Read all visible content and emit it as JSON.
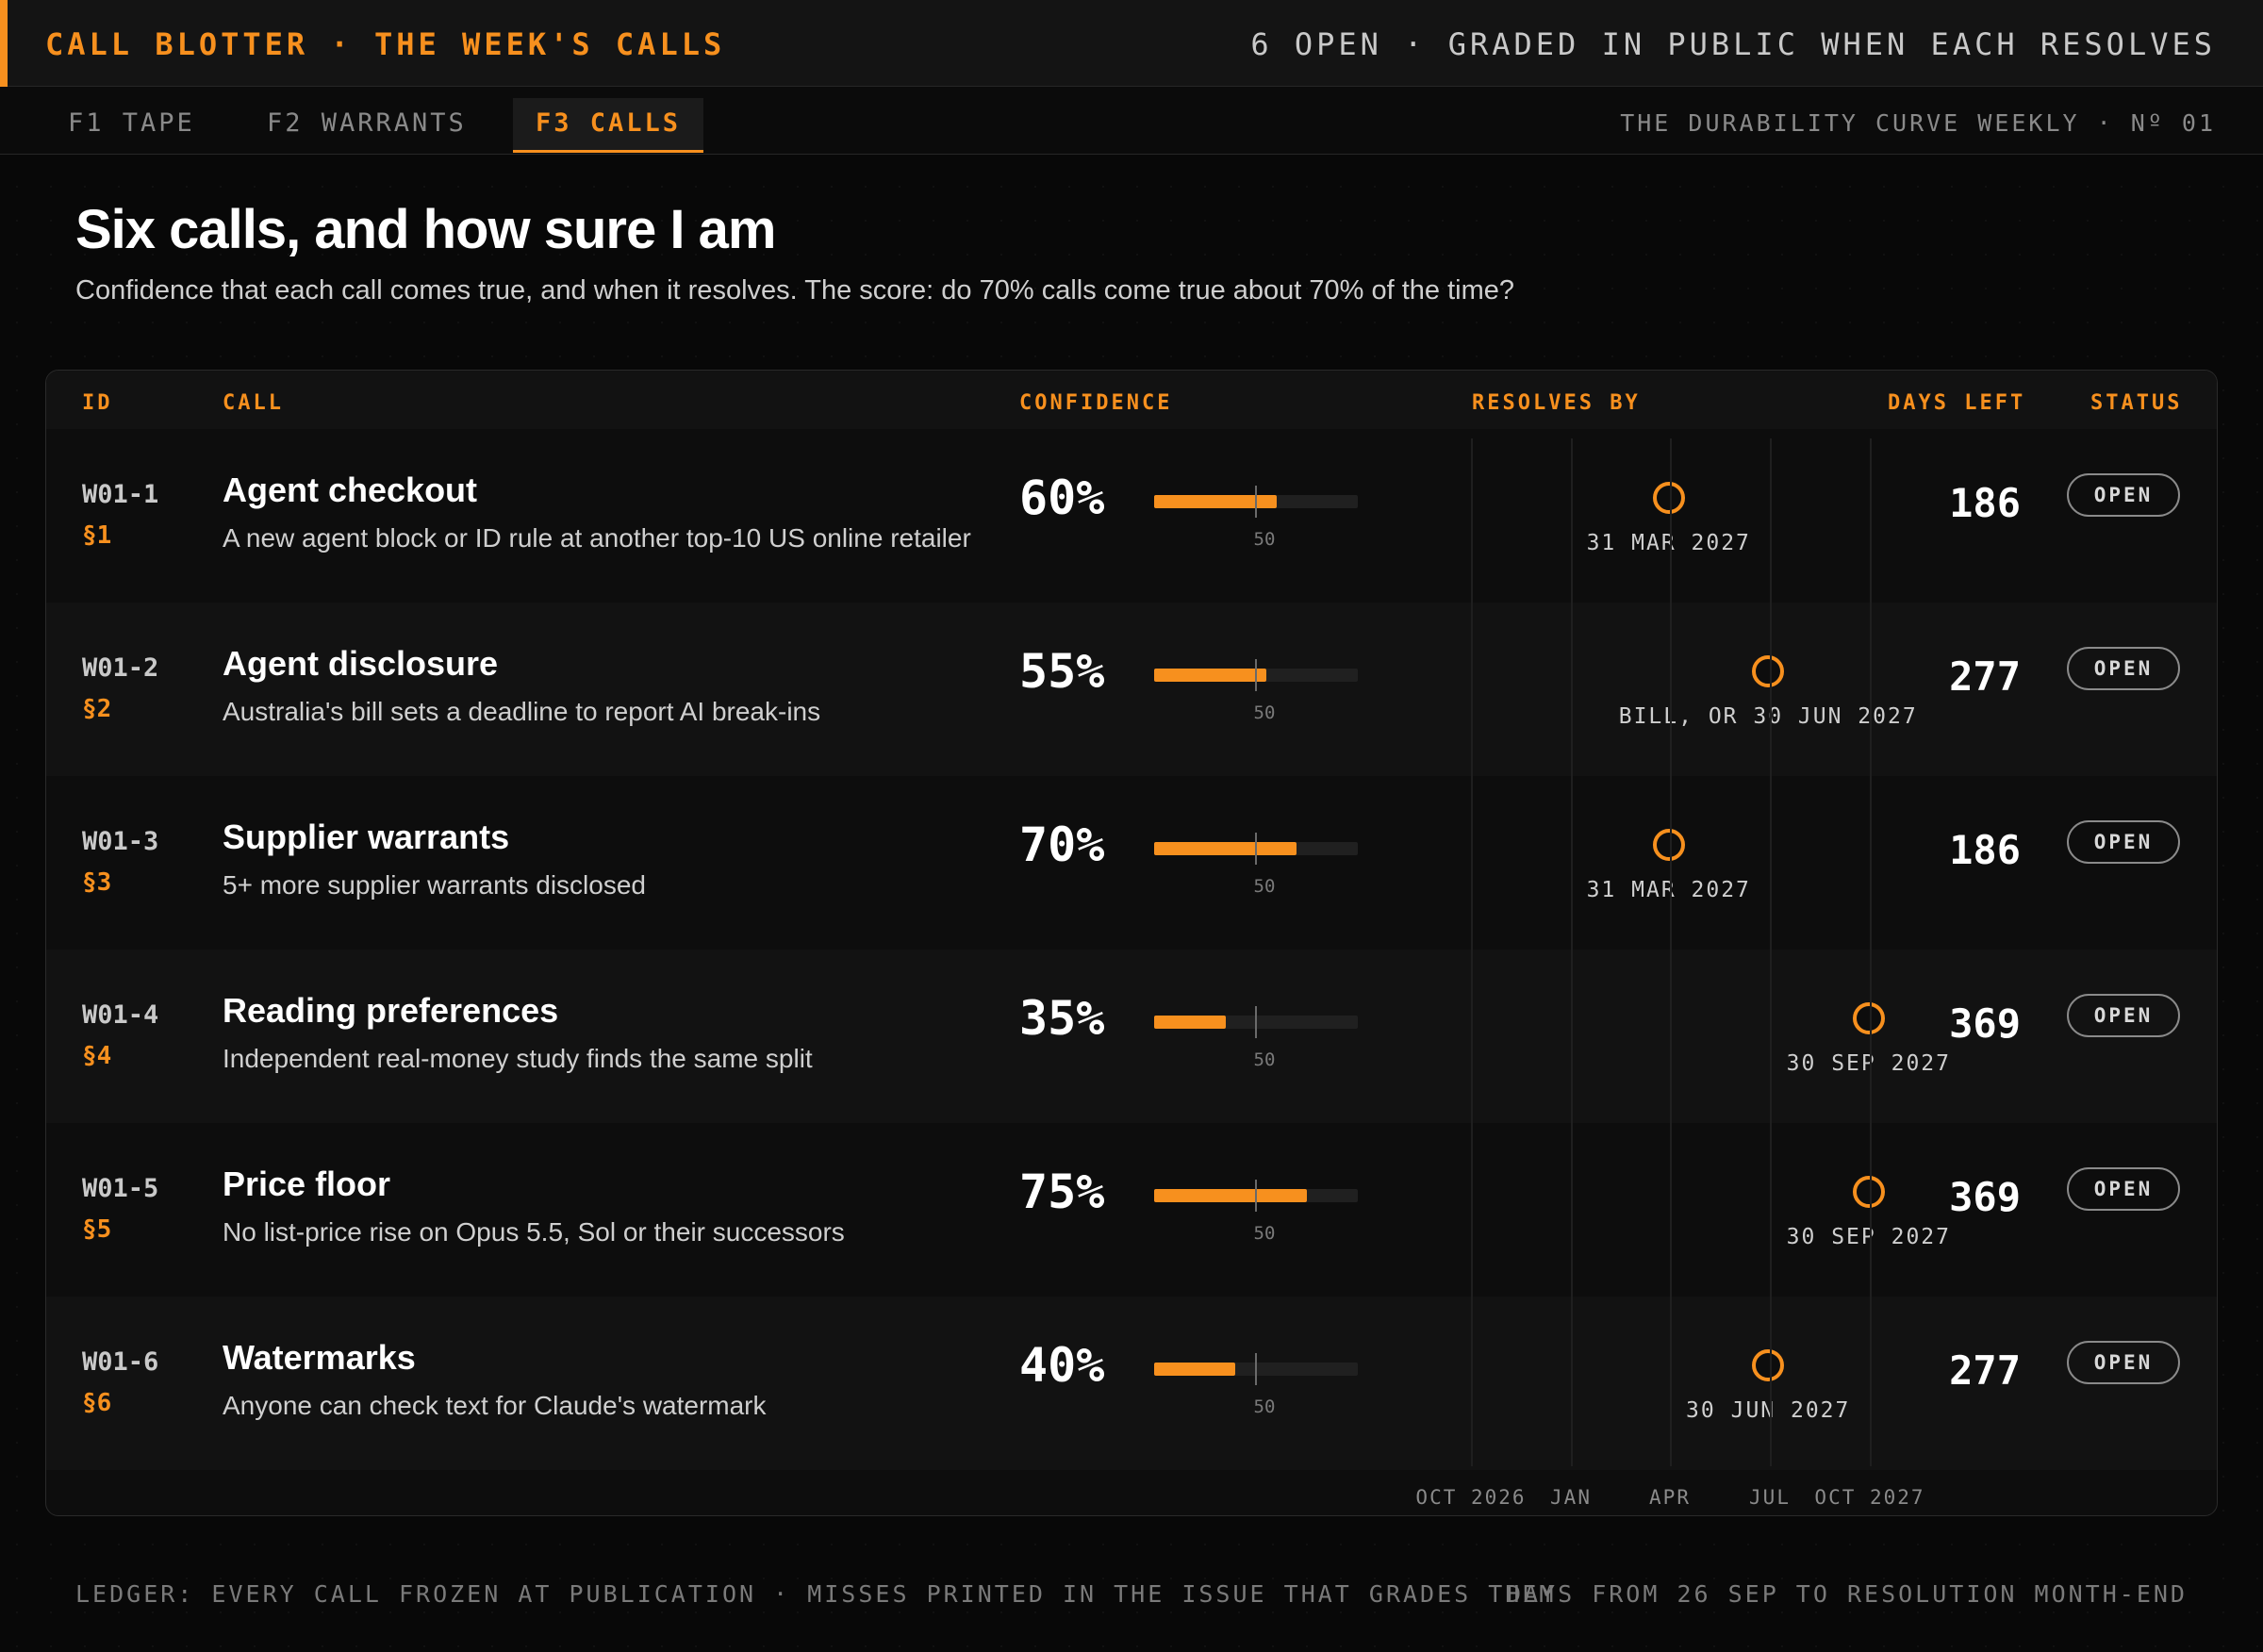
{
  "header": {
    "title": "CALL BLOTTER · THE WEEK'S CALLS",
    "status_line": "6 OPEN · GRADED IN PUBLIC WHEN EACH RESOLVES",
    "accent_color": "#f7901e"
  },
  "tabs": [
    {
      "label": "F1 TAPE",
      "active": false
    },
    {
      "label": "F2 WARRANTS",
      "active": false
    },
    {
      "label": "F3 CALLS",
      "active": true
    }
  ],
  "issue_label": "THE DURABILITY CURVE WEEKLY · Nº 01",
  "page": {
    "title": "Six calls, and how sure I am",
    "subtitle": "Confidence that each call comes true, and when it resolves. The score: do 70% calls come true about 70% of the time?"
  },
  "table": {
    "columns": [
      "ID",
      "CALL",
      "CONFIDENCE",
      "RESOLVES BY",
      "DAYS LEFT",
      "STATUS"
    ],
    "confidence_midpoint_label": "50",
    "timeline_axis": [
      "OCT 2026",
      "JAN",
      "APR",
      "JUL",
      "OCT 2027"
    ],
    "rows": [
      {
        "id": "W01-1",
        "section": "§1",
        "title": "Agent checkout",
        "description": "A new agent block or ID rule at another top-10 US online retailer",
        "confidence": "60%",
        "confidence_value": 60,
        "resolves_label": "31 MAR 2027",
        "resolves_date": "2027-03-31",
        "days_left": "186",
        "status": "OPEN"
      },
      {
        "id": "W01-2",
        "section": "§2",
        "title": "Agent disclosure",
        "description": "Australia's bill sets a deadline to report AI break-ins",
        "confidence": "55%",
        "confidence_value": 55,
        "resolves_label": "BILL, OR 30 JUN 2027",
        "resolves_date": "2027-06-30",
        "days_left": "277",
        "status": "OPEN"
      },
      {
        "id": "W01-3",
        "section": "§3",
        "title": "Supplier warrants",
        "description": "5+ more supplier warrants disclosed",
        "confidence": "70%",
        "confidence_value": 70,
        "resolves_label": "31 MAR 2027",
        "resolves_date": "2027-03-31",
        "days_left": "186",
        "status": "OPEN"
      },
      {
        "id": "W01-4",
        "section": "§4",
        "title": "Reading preferences",
        "description": "Independent real-money study finds the same split",
        "confidence": "35%",
        "confidence_value": 35,
        "resolves_label": "30 SEP 2027",
        "resolves_date": "2027-09-30",
        "days_left": "369",
        "status": "OPEN"
      },
      {
        "id": "W01-5",
        "section": "§5",
        "title": "Price floor",
        "description": "No list-price rise on Opus 5.5, Sol or their successors",
        "confidence": "75%",
        "confidence_value": 75,
        "resolves_label": "30 SEP 2027",
        "resolves_date": "2027-09-30",
        "days_left": "369",
        "status": "OPEN"
      },
      {
        "id": "W01-6",
        "section": "§6",
        "title": "Watermarks",
        "description": "Anyone can check text for Claude's watermark",
        "confidence": "40%",
        "confidence_value": 40,
        "resolves_label": "30 JUN 2027",
        "resolves_date": "2027-06-30",
        "days_left": "277",
        "status": "OPEN"
      }
    ]
  },
  "footer": {
    "left": "LEDGER: EVERY CALL FROZEN AT PUBLICATION · MISSES PRINTED IN THE ISSUE THAT GRADES THEM",
    "right": "DAYS FROM 26 SEP TO RESOLUTION MONTH-END"
  }
}
